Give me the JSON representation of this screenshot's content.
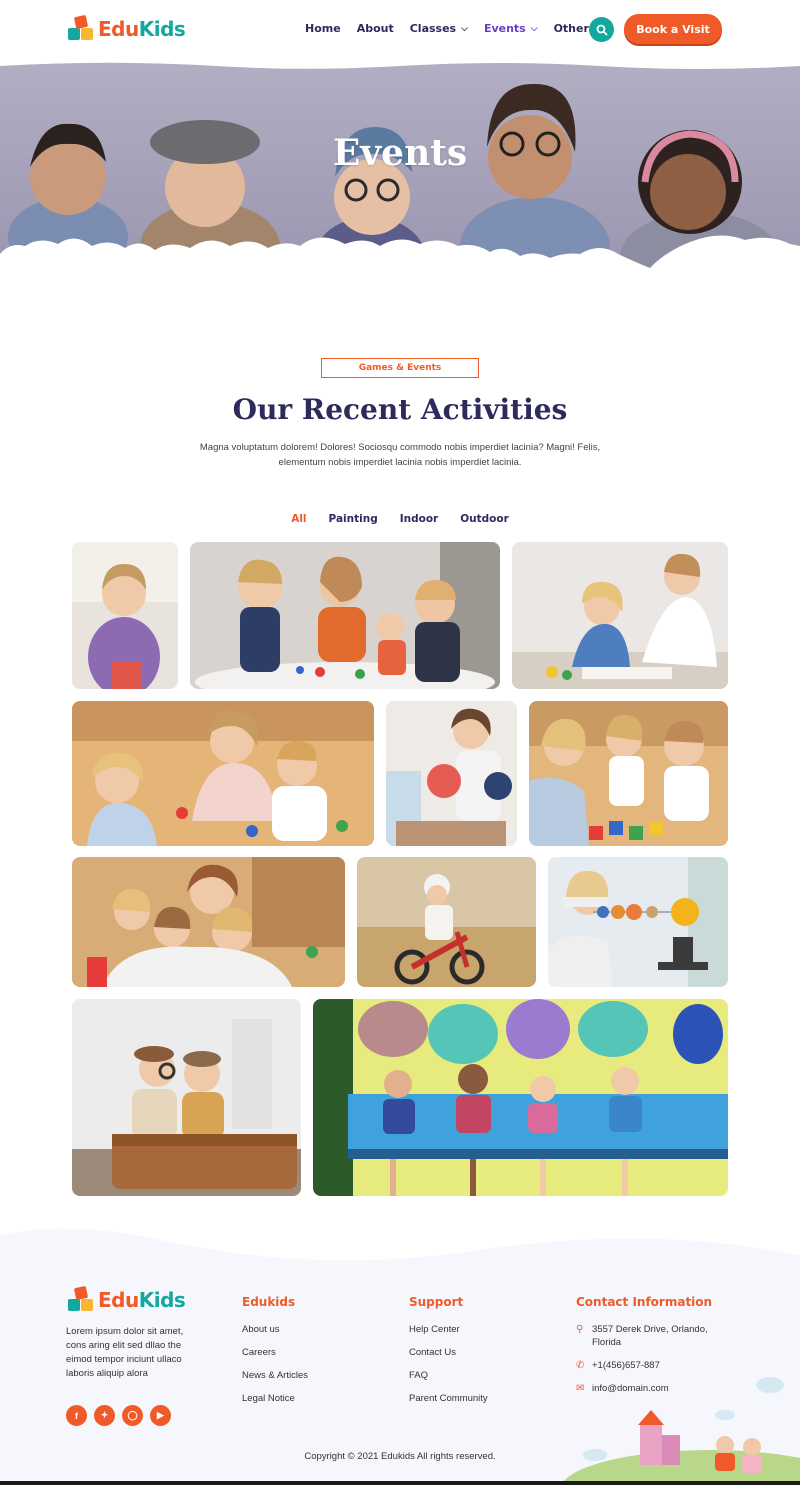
{
  "brand": {
    "name_part1": "Edu",
    "name_part2": "Kids",
    "colors": {
      "orange": "#f05a28",
      "teal": "#13a89e",
      "navy": "#2d2a5c"
    }
  },
  "nav": {
    "items": [
      {
        "label": "Home",
        "dropdown": false,
        "active": false
      },
      {
        "label": "About",
        "dropdown": false,
        "active": false
      },
      {
        "label": "Classes",
        "dropdown": true,
        "active": false
      },
      {
        "label": "Events",
        "dropdown": true,
        "active": true
      },
      {
        "label": "Other",
        "dropdown": true,
        "active": false
      }
    ],
    "search_icon": "search-icon",
    "cta_label": "Book a Visit"
  },
  "hero": {
    "title": "Events"
  },
  "section": {
    "tagline": "Games & Events",
    "title": "Our Recent Activities",
    "description": "Magna voluptatum dolorem! Dolores! Sociosqu commodo nobis imperdiet lacinia? Magni! Felis, elementum nobis imperdiet lacinia nobis imperdiet lacinia."
  },
  "filters": [
    {
      "label": "All",
      "active": true
    },
    {
      "label": "Painting",
      "active": false
    },
    {
      "label": "Indoor",
      "active": false
    },
    {
      "label": "Outdoor",
      "active": false
    }
  ],
  "footer": {
    "about": "Lorem ipsum dolor sit amet, cons aring elit sed dllao the eimod tempor inciunt ullaco laboris aliquip alora",
    "socials": [
      "facebook-icon",
      "twitter-icon",
      "instagram-icon",
      "youtube-icon"
    ],
    "col1": {
      "title": "Edukids",
      "links": [
        "About us",
        "Careers",
        "News & Articles",
        "Legal Notice"
      ]
    },
    "col2": {
      "title": "Support",
      "links": [
        "Help Center",
        "Contact Us",
        "FAQ",
        "Parent Community"
      ]
    },
    "col3": {
      "title": "Contact Information",
      "address": "3557 Derek Drive, Orlando, Florida",
      "phone": "+1(456)657-887",
      "email": "info@domain.com"
    },
    "copyright": "Copyright © 2021 Edukids  All rights reserved."
  }
}
